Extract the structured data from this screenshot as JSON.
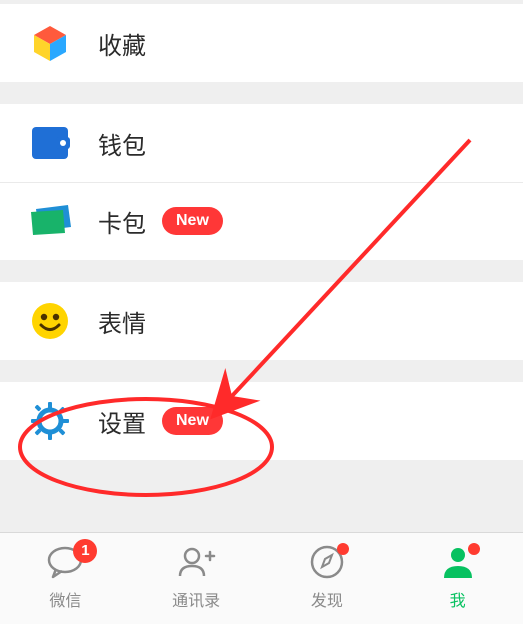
{
  "sections": {
    "favorites": {
      "label": "收藏"
    },
    "wallet": {
      "label": "钱包"
    },
    "cards": {
      "label": "卡包",
      "badge": "New"
    },
    "stickers": {
      "label": "表情"
    },
    "settings": {
      "label": "设置",
      "badge": "New"
    }
  },
  "tabs": {
    "chat": {
      "label": "微信",
      "count": "1"
    },
    "contacts": {
      "label": "通讯录"
    },
    "discover": {
      "label": "发现"
    },
    "me": {
      "label": "我"
    }
  },
  "colors": {
    "accent": "#07c160",
    "badge": "#ff3b30"
  }
}
